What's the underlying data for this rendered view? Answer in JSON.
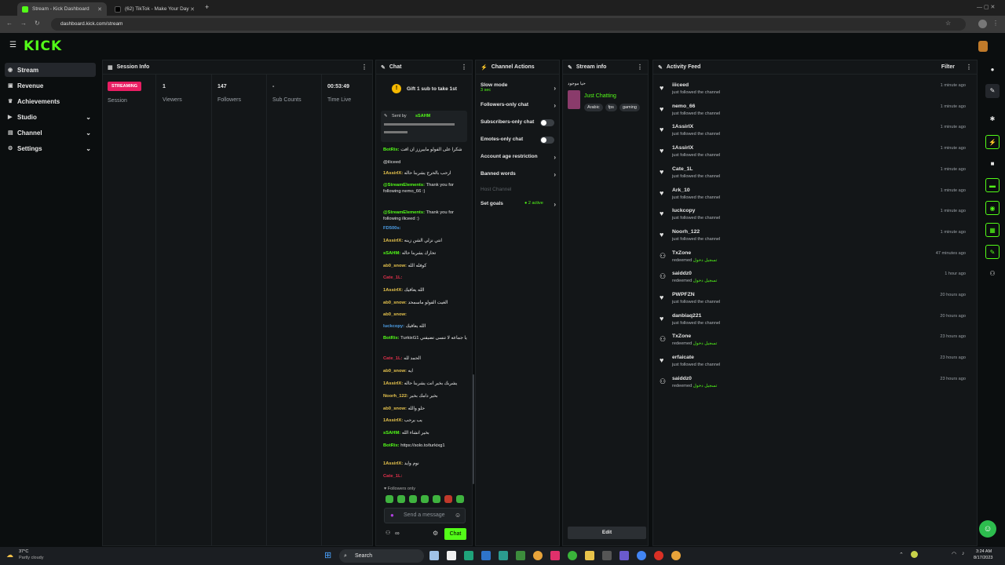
{
  "browser": {
    "tabs": [
      {
        "title": "Stream - Kick Dashboard"
      },
      {
        "title": "(62) TikTok - Make Your Day"
      }
    ],
    "url": "dashboard.kick.com/stream",
    "new_tab": "+"
  },
  "header": {
    "logo": "KICK"
  },
  "sidebar": {
    "items": [
      {
        "label": "Stream",
        "icon": "broadcast-icon"
      },
      {
        "label": "Revenue",
        "icon": "dollar-icon"
      },
      {
        "label": "Achievements",
        "icon": "trophy-icon"
      },
      {
        "label": "Studio",
        "icon": "studio-icon"
      },
      {
        "label": "Channel",
        "icon": "channel-icon"
      },
      {
        "label": "Settings",
        "icon": "gear-icon"
      }
    ]
  },
  "session": {
    "title": "Session Info",
    "status": "STREAMING",
    "status_label": "Session",
    "stats": [
      {
        "value": "1",
        "label": "Viewers"
      },
      {
        "value": "147",
        "label": "Followers"
      },
      {
        "value": "-",
        "label": "Sub Counts"
      },
      {
        "value": "00:53:49",
        "label": "Time Live"
      }
    ]
  },
  "chat": {
    "title": "Chat",
    "gift_prompt": "Gift 1 sub to take 1st",
    "pinned_by": "Sent by",
    "pinned_user": "sSAHM",
    "messages": [
      {
        "user": "BotRix:",
        "text": "شكرا على الفولو ماييرزز ان افت",
        "color": "#53fc18"
      },
      {
        "user": "",
        "text": "@iliceed",
        "color": "#e6e6e6"
      },
      {
        "user": "1AssirIX:",
        "text": "ارحب بالحرج يشربنا حاله",
        "color": "#e6c34d"
      },
      {
        "user": "@StreamElements:",
        "text": "Thank you for following nemo_66 :)",
        "color": "#53fc18"
      },
      {
        "user": "@StreamElements:",
        "text": "Thank you for following iliceed :)",
        "color": "#53fc18"
      },
      {
        "user": "FD500s:",
        "text": "",
        "color": "#4d9ee6"
      },
      {
        "user": "1AssirIX:",
        "text": "انتي نزلي الشن زينه",
        "color": "#e6c34d"
      },
      {
        "user": "sSAHM:",
        "text": "تحارك يشربنا حاله",
        "color": "#53fc18"
      },
      {
        "user": "ab0_snow:",
        "text": "كوفله الله",
        "color": "#e6c34d"
      },
      {
        "user": "Cate_1L:",
        "text": "",
        "color": "#e0304b"
      },
      {
        "user": "1AssirIX:",
        "text": "الله يعافيك",
        "color": "#e6c34d"
      },
      {
        "user": "ab0_snow:",
        "text": "الغيت الفولو ماسمحد",
        "color": "#e6c34d"
      },
      {
        "user": "ab0_snow:",
        "text": "",
        "color": "#e6c34d"
      },
      {
        "user": "luckcopy:",
        "text": "الله يعافيك",
        "color": "#4d9ee6"
      },
      {
        "user": "BotRix:",
        "text": "TurkixG1 يا جماعه لا تنسى تضيفني",
        "color": "#53fc18"
      },
      {
        "user": "Cate_1L:",
        "text": "الحمد لله",
        "color": "#e0304b"
      },
      {
        "user": "ab0_snow:",
        "text": "ايه",
        "color": "#e6c34d"
      },
      {
        "user": "1AssirIX:",
        "text": "يشربك بخير انت يشربنا حاله",
        "color": "#e6c34d"
      },
      {
        "user": "Noorh_122:",
        "text": "بخير دامك بخير",
        "color": "#e6c34d"
      },
      {
        "user": "ab0_snow:",
        "text": "حلو والله",
        "color": "#e6c34d"
      },
      {
        "user": "1AssirIX:",
        "text": "يب يرحب",
        "color": "#e6c34d"
      },
      {
        "user": "sSAHM:",
        "text": "بخير انشاء الله",
        "color": "#53fc18"
      },
      {
        "user": "BotRix:",
        "text": "https://solo.to/turkixg1",
        "color": "#53fc18"
      },
      {
        "user": "1AssirIX:",
        "text": "نوم وايد",
        "color": "#e6c34d"
      },
      {
        "user": "Cate_1L:",
        "text": "",
        "color": "#e0304b"
      }
    ],
    "followers_only": "Followers only",
    "input_placeholder": "Send a message",
    "send_label": "Chat",
    "infinity": "∞"
  },
  "channel_actions": {
    "title": "Channel Actions",
    "slow_mode": "Slow mode",
    "slow_mode_value": "3 sec",
    "followers_only": "Followers-only chat",
    "subscribers_only": "Subscribers-only chat",
    "emotes_only": "Emotes-only chat",
    "account_age": "Account age restriction",
    "banned_words": "Banned words",
    "host_channel": "Host Channel",
    "set_goals": "Set goals",
    "goals_active": "2 active"
  },
  "stream_info": {
    "title": "Stream info",
    "stream_title": "حيا موجود",
    "category": "Just Chatting",
    "tags": [
      "Arabic",
      "fps",
      "gaming"
    ],
    "edit_label": "Edit"
  },
  "activity": {
    "title": "Activity Feed",
    "filter_label": "Filter",
    "items": [
      {
        "name": "iiiceed",
        "action": "just followed the channel",
        "reward": "",
        "time": "1 minute ago",
        "type": "follow"
      },
      {
        "name": "nemo_66",
        "action": "just followed the channel",
        "reward": "",
        "time": "1 minute ago",
        "type": "follow"
      },
      {
        "name": "1AssirIX",
        "action": "just followed the channel",
        "reward": "",
        "time": "1 minute ago",
        "type": "follow"
      },
      {
        "name": "1AssirIX",
        "action": "just followed the channel",
        "reward": "",
        "time": "1 minute ago",
        "type": "follow"
      },
      {
        "name": "Cate_1L",
        "action": "just followed the channel",
        "reward": "",
        "time": "1 minute ago",
        "type": "follow"
      },
      {
        "name": "Ark_10",
        "action": "just followed the channel",
        "reward": "",
        "time": "1 minute ago",
        "type": "follow"
      },
      {
        "name": "luckcopy",
        "action": "just followed the channel",
        "reward": "",
        "time": "1 minute ago",
        "type": "follow"
      },
      {
        "name": "Noorh_122",
        "action": "just followed the channel",
        "reward": "",
        "time": "1 minute ago",
        "type": "follow"
      },
      {
        "name": "TxZone",
        "action": "redeemed",
        "reward": "تسجيل دخول",
        "time": "47 minutes ago",
        "type": "redeem"
      },
      {
        "name": "saiddz0",
        "action": "redeemed",
        "reward": "تسجيل دخول",
        "time": "1 hour ago",
        "type": "redeem"
      },
      {
        "name": "PWPFZN",
        "action": "just followed the channel",
        "reward": "",
        "time": "20 hours ago",
        "type": "follow"
      },
      {
        "name": "danbiaq221",
        "action": "just followed the channel",
        "reward": "",
        "time": "20 hours ago",
        "type": "follow"
      },
      {
        "name": "TxZone",
        "action": "redeemed",
        "reward": "تسجيل دخول",
        "time": "23 hours ago",
        "type": "redeem"
      },
      {
        "name": "erfaicate",
        "action": "just followed the channel",
        "reward": "",
        "time": "23 hours ago",
        "type": "follow"
      },
      {
        "name": "saiddz0",
        "action": "redeemed",
        "reward": "تسجيل دخول",
        "time": "23 hours ago",
        "type": "redeem"
      }
    ]
  },
  "taskbar": {
    "weather_temp": "37°C",
    "weather_desc": "Partly cloudy",
    "search_label": "Search",
    "time": "3:24 AM",
    "date": "8/17/2023"
  },
  "colors": {
    "accent": "#53fc18",
    "streaming": "#e91e63",
    "panel": "#131618"
  }
}
